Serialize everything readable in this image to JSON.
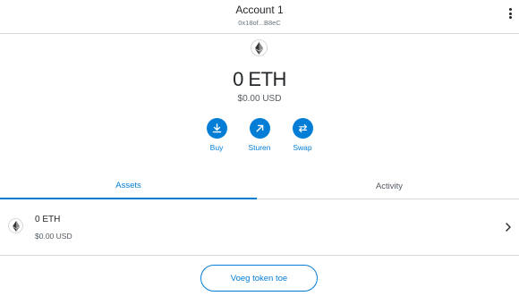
{
  "account": {
    "name": "Account 1",
    "address": "0x18of...B8eC"
  },
  "balance": {
    "amount": "0 ETH",
    "fiat": "$0.00 USD"
  },
  "actions": [
    {
      "label": "Buy",
      "icon": "download-icon"
    },
    {
      "label": "Sturen",
      "icon": "arrow-up-right-icon"
    },
    {
      "label": "Swap",
      "icon": "swap-icon"
    }
  ],
  "tabs": [
    {
      "label": "Assets",
      "active": true
    },
    {
      "label": "Activity",
      "active": false
    }
  ],
  "assets": [
    {
      "amount": "0 ETH",
      "fiat": "$0.00 USD",
      "icon": "ethereum-icon"
    }
  ],
  "add_token_label": "Voeg token toe",
  "colors": {
    "accent": "#037dd6",
    "text": "#24272a",
    "muted": "#535a61",
    "divider": "#d6d9dc"
  }
}
